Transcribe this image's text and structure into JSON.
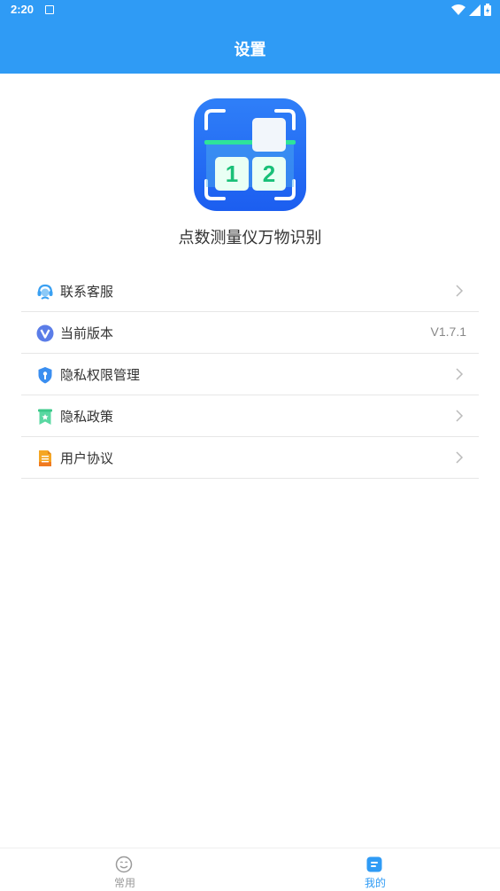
{
  "status": {
    "time": "2:20"
  },
  "header": {
    "title": "设置"
  },
  "app": {
    "name": "点数测量仪万物识别",
    "logo_digits": [
      "1",
      "2"
    ]
  },
  "menu": {
    "items": [
      {
        "label": "联系客服",
        "icon": "customer-service-icon"
      },
      {
        "label": "当前版本",
        "icon": "version-icon",
        "value": "V1.7.1"
      },
      {
        "label": "隐私权限管理",
        "icon": "privacy-shield-icon"
      },
      {
        "label": "隐私政策",
        "icon": "privacy-policy-icon"
      },
      {
        "label": "用户协议",
        "icon": "user-agreement-icon"
      }
    ]
  },
  "tabbar": {
    "tabs": [
      {
        "label": "常用",
        "icon": "smiley-icon",
        "active": false
      },
      {
        "label": "我的",
        "icon": "profile-icon",
        "active": true
      }
    ]
  },
  "colors": {
    "primary": "#2f9bf5",
    "text": "#333333",
    "muted": "#888888",
    "divider": "#e6e6e6"
  }
}
